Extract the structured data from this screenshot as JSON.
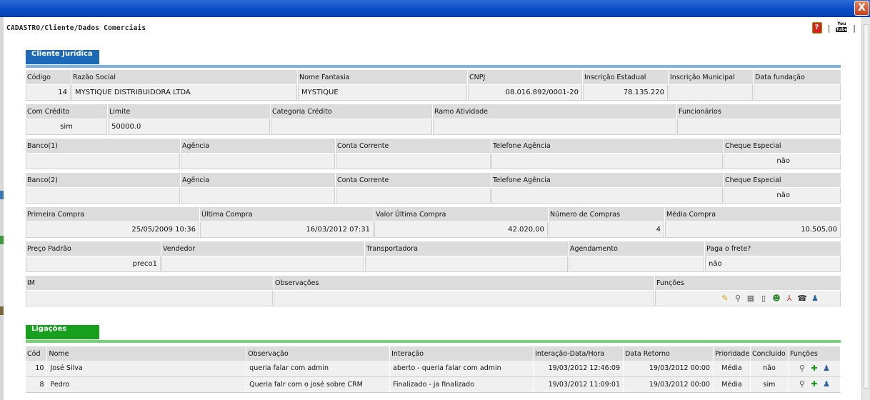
{
  "window": {
    "close_symbol": "X"
  },
  "breadcrumb": "CADASTRO/Cliente/Dados Comerciais",
  "top_icons": [
    {
      "name": "help-icon",
      "glyph": "?"
    },
    {
      "name": "youtube-icon",
      "glyph": "You Tube"
    }
  ],
  "separator": "|",
  "cliente": {
    "section_title": "Cliente Jurídica",
    "row1": {
      "labels": {
        "codigo": "Código",
        "razao": "Razão Social",
        "fantasia": "Nome Fantasia",
        "cnpj": "CNPJ",
        "ie": "Inscrição Estadual",
        "im": "Inscrição Municipal",
        "fundacao": "Data fundação"
      },
      "values": {
        "codigo": "14",
        "razao": "MYSTIQUE DISTRIBUIDORA LTDA",
        "fantasia": "MYSTIQUE",
        "cnpj": "08.016.892/0001-20",
        "ie": "78.135.220",
        "im": "",
        "fundacao": ""
      }
    },
    "row2": {
      "labels": {
        "com_credito": "Com Crédito",
        "limite": "Limite",
        "categoria": "Categoria Crédito",
        "ramo": "Ramo Atividade",
        "funcionarios": "Funcionários"
      },
      "values": {
        "com_credito": "sim",
        "limite": "50000.0",
        "categoria": "",
        "ramo": "",
        "funcionarios": ""
      }
    },
    "row3": {
      "labels": {
        "banco": "Banco(1)",
        "agencia": "Agência",
        "conta": "Conta Corrente",
        "telefone": "Telefone Agência",
        "cheque": "Cheque Especial"
      },
      "values": {
        "banco": "",
        "agencia": "",
        "conta": "",
        "telefone": "",
        "cheque": "não"
      }
    },
    "row4": {
      "labels": {
        "banco": "Banco(2)",
        "agencia": "Agência",
        "conta": "Conta Corrente",
        "telefone": "Telefone Agência",
        "cheque": "Cheque Especial"
      },
      "values": {
        "banco": "",
        "agencia": "",
        "conta": "",
        "telefone": "",
        "cheque": "não"
      }
    },
    "row5": {
      "labels": {
        "primeira": "Primeira Compra",
        "ultima": "Última Compra",
        "valor": "Valor Última Compra",
        "numero": "Número de Compras",
        "media": "Média Compra"
      },
      "values": {
        "primeira": "25/05/2009 10:36",
        "ultima": "16/03/2012 07:31",
        "valor": "42.020,00",
        "numero": "4",
        "media": "10.505,00"
      }
    },
    "row6": {
      "labels": {
        "preco": "Preço Padrão",
        "vendedor": "Vendedor",
        "transportadora": "Transportadora",
        "agendamento": "Agendamento",
        "frete": "Paga o frete?"
      },
      "values": {
        "preco": "preco1",
        "vendedor": "",
        "transportadora": "",
        "agendamento": "",
        "frete": "não"
      }
    },
    "row7": {
      "labels": {
        "im": "IM",
        "obs": "Observações",
        "funcoes": "Funções"
      },
      "values": {
        "im": "",
        "obs": ""
      },
      "function_icons": [
        "pencil-icon",
        "magnifier-icon",
        "calculator-icon",
        "document-icon",
        "user-icon",
        "pdf-icon",
        "phone-icon",
        "users-icon"
      ]
    }
  },
  "ligacoes": {
    "section_title": "Ligações",
    "columns": [
      "Cód",
      "Nome",
      "Observação",
      "Interação",
      "Interação-Data/Hora",
      "Data Retorno",
      "Prioridade",
      "Concluido",
      "Funções"
    ],
    "rows": [
      {
        "cod": "10",
        "nome": "José Silva",
        "obs": "queria falar com admin",
        "interacao": "aberto -  queria falar com admin",
        "data_hora": "19/03/2012 12:46:09",
        "retorno": "19/03/2012  00:00",
        "prioridade": "Média",
        "concluido": "não"
      },
      {
        "cod": "8",
        "nome": "Pedro",
        "obs": "Queria falr com o josé sobre CRM",
        "interacao": "Finalizado -  ja finalizado",
        "data_hora": "19/03/2012 11:09:01",
        "retorno": "19/03/2012  00:00",
        "prioridade": "Média",
        "concluido": "sim"
      }
    ]
  }
}
